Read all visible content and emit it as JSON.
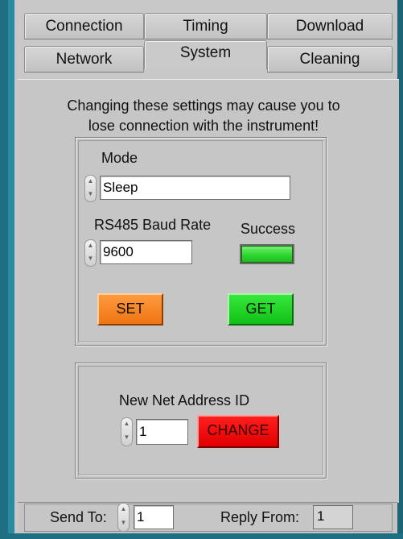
{
  "tabs": {
    "row1": [
      "Connection",
      "Timing",
      "Download"
    ],
    "row2": [
      "Network",
      "System",
      "Cleaning"
    ],
    "active": "System"
  },
  "warning": {
    "line1": "Changing these settings may cause you to",
    "line2": "lose connection with the instrument!"
  },
  "settings": {
    "mode_label": "Mode",
    "mode_value": "Sleep",
    "baud_label": "RS485 Baud Rate",
    "baud_value": "9600",
    "success_label": "Success",
    "success_led_color": "#2ed62e",
    "set_label": "SET",
    "get_label": "GET"
  },
  "net_address": {
    "label": "New Net Address ID",
    "value": "1",
    "change_label": "CHANGE"
  },
  "footer": {
    "send_to_label": "Send To:",
    "send_to_value": "1",
    "reply_from_label": "Reply From:",
    "reply_from_value": "1"
  },
  "colors": {
    "set_button": "#ef7412",
    "get_button": "#12c017",
    "change_button": "#e00000",
    "change_text": "#3a0000"
  }
}
